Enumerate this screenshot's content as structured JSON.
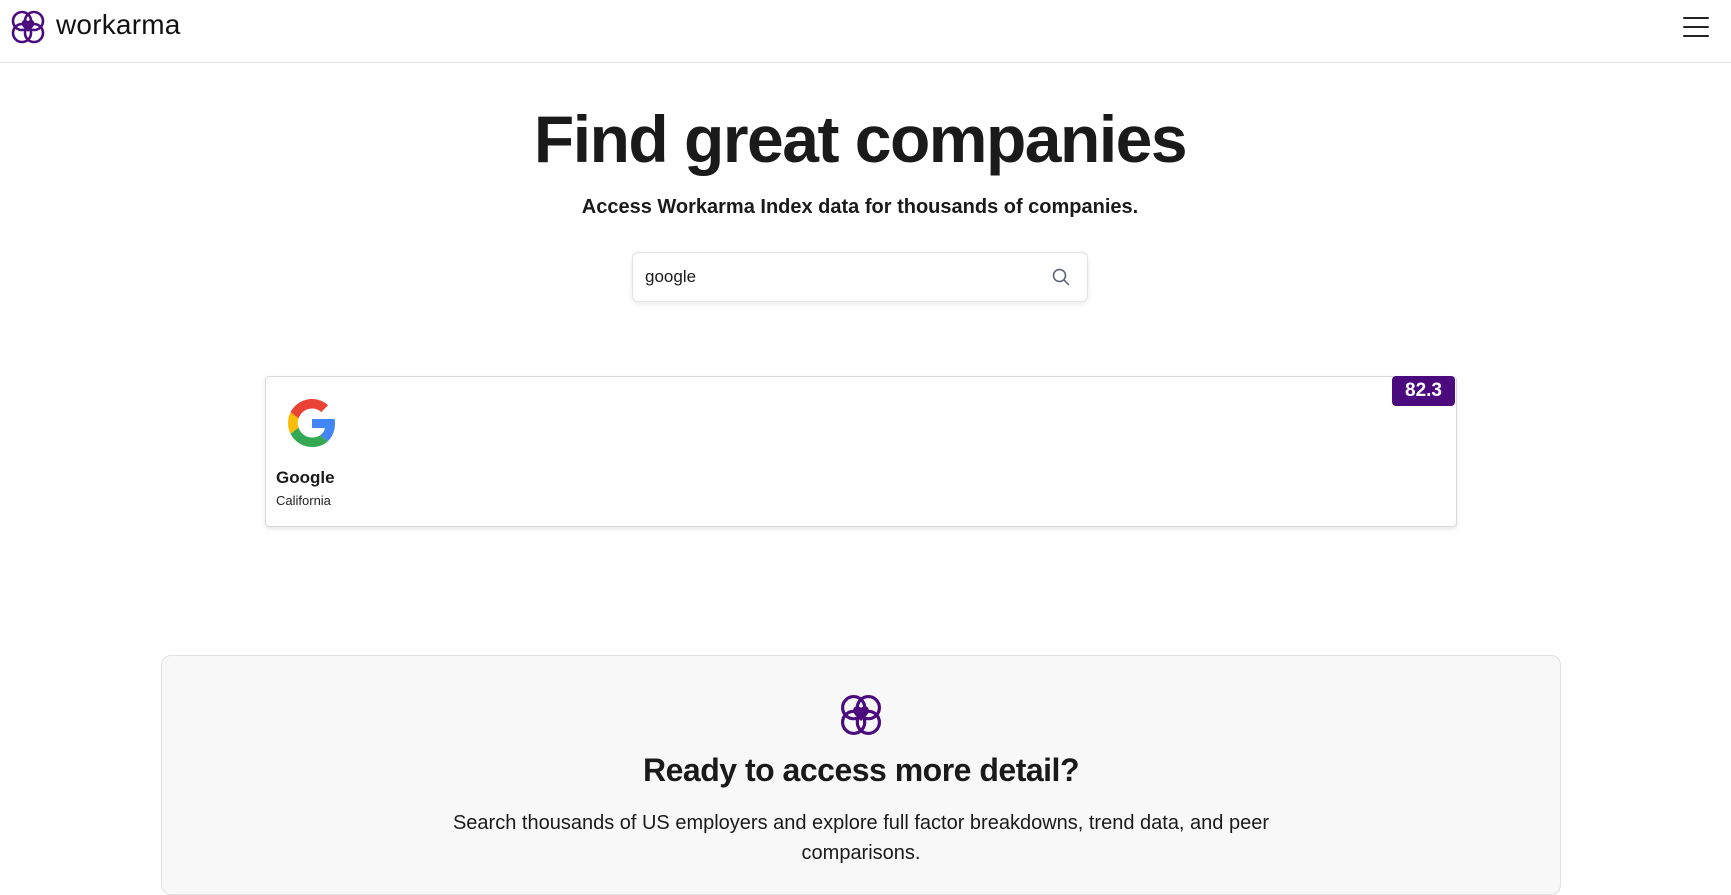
{
  "header": {
    "brand": "workarma",
    "logo_icon": "workarma-logo-icon",
    "menu_icon": "hamburger-menu-icon",
    "brand_color": "#4b0a7d"
  },
  "hero": {
    "title": "Find great companies",
    "subtitle": "Access Workarma Index data for thousands of companies."
  },
  "search": {
    "value": "google",
    "icon": "search-icon"
  },
  "results": [
    {
      "name": "Google",
      "location": "California",
      "score": "82.3",
      "logo_icon": "google-logo-icon",
      "badge_color": "#4b0a7d"
    }
  ],
  "cta": {
    "icon": "workarma-logo-icon",
    "title": "Ready to access more detail?",
    "text": "Search thousands of US employers and explore full factor breakdowns, trend data, and peer comparisons."
  }
}
